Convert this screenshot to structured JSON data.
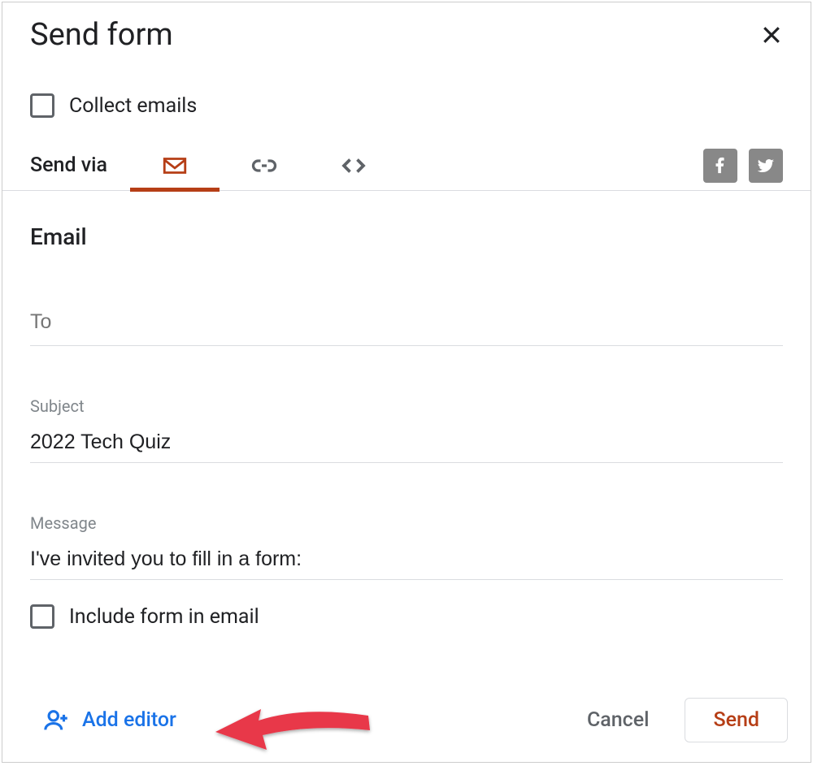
{
  "dialog": {
    "title": "Send form",
    "collect_emails_label": "Collect emails",
    "send_via_label": "Send via",
    "section_title": "Email",
    "to_placeholder": "To",
    "to_value": "",
    "subject_label": "Subject",
    "subject_value": "2022 Tech Quiz",
    "message_label": "Message",
    "message_value": "I've invited you to fill in a form:",
    "include_form_label": "Include form in email",
    "add_editor_label": "Add editor",
    "cancel_label": "Cancel",
    "send_label": "Send"
  },
  "tabs": {
    "active": "email",
    "items": [
      "email",
      "link",
      "embed"
    ]
  },
  "colors": {
    "accent": "#b63e16",
    "link": "#1a73e8",
    "arrow": "#e8374a"
  }
}
